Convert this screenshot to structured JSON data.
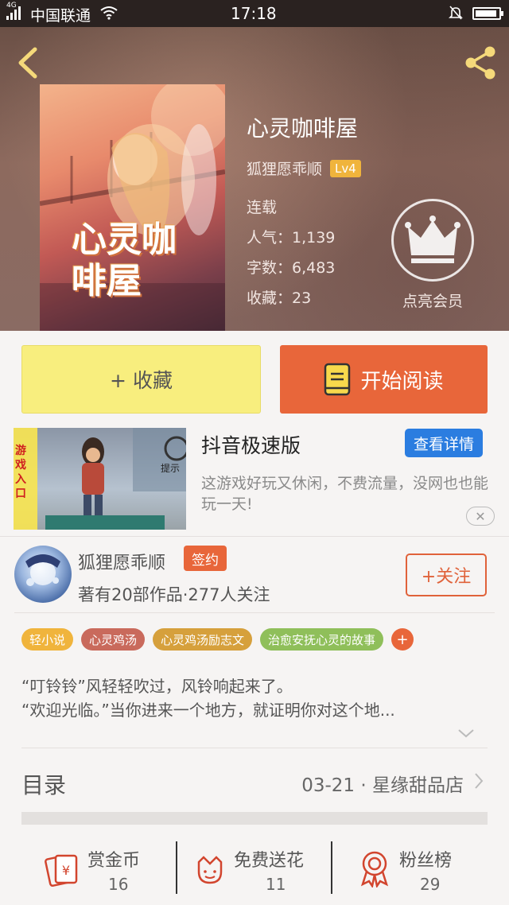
{
  "status_bar": {
    "network": "4G",
    "carrier": "中国联通",
    "time": "17:18"
  },
  "header": {
    "book_title": "心灵咖啡屋",
    "cover_title": "心灵咖啡屋",
    "author": "狐狸愿乖顺",
    "level": "Lv4",
    "status": "连载",
    "popularity": "人气：1,139",
    "word_count": "字数：6,483",
    "favorites": "收藏：23",
    "vip_label": "点亮会员"
  },
  "actions": {
    "favorite_label": "+ 收藏",
    "read_label": "开始阅读"
  },
  "ad": {
    "title": "抖音极速版",
    "detail_button": "查看详情",
    "description": "这游戏好玩又休闲，不费流量，没网也也能玩一天!",
    "image_text_side": "游戏入口",
    "image_text_hint": "提示"
  },
  "author_section": {
    "name": "狐狸愿乖顺",
    "badge": "签约",
    "stats": "著有20部作品·277人关注",
    "follow_button": "+关注"
  },
  "tags": [
    {
      "label": "轻小说",
      "color": "#f0b43c"
    },
    {
      "label": "心灵鸡汤",
      "color": "#c96a5c"
    },
    {
      "label": "心灵鸡汤励志文",
      "color": "#d6a03c"
    },
    {
      "label": "治愈安抚心灵的故事",
      "color": "#8fbf5a"
    }
  ],
  "tag_add": "+",
  "description": {
    "line1": "“叮铃铃”风轻轻吹过，风铃响起来了。",
    "line2": "“欢迎光临。”当你进来一个地方，就证明你对这个地..."
  },
  "toc": {
    "label": "目录",
    "latest": "03-21 · 星缘甜品店"
  },
  "bottom_bar": [
    {
      "icon": "coin-envelope-icon",
      "label": "赏金币",
      "count": "16"
    },
    {
      "icon": "flower-icon",
      "label": "免费送花",
      "count": "11"
    },
    {
      "icon": "medal-icon",
      "label": "粉丝榜",
      "count": "29"
    }
  ],
  "colors": {
    "accent_orange": "#e8663a",
    "fav_yellow": "#f8ee7e",
    "ad_blue": "#2b7de0",
    "level_gold": "#f0b43c"
  }
}
